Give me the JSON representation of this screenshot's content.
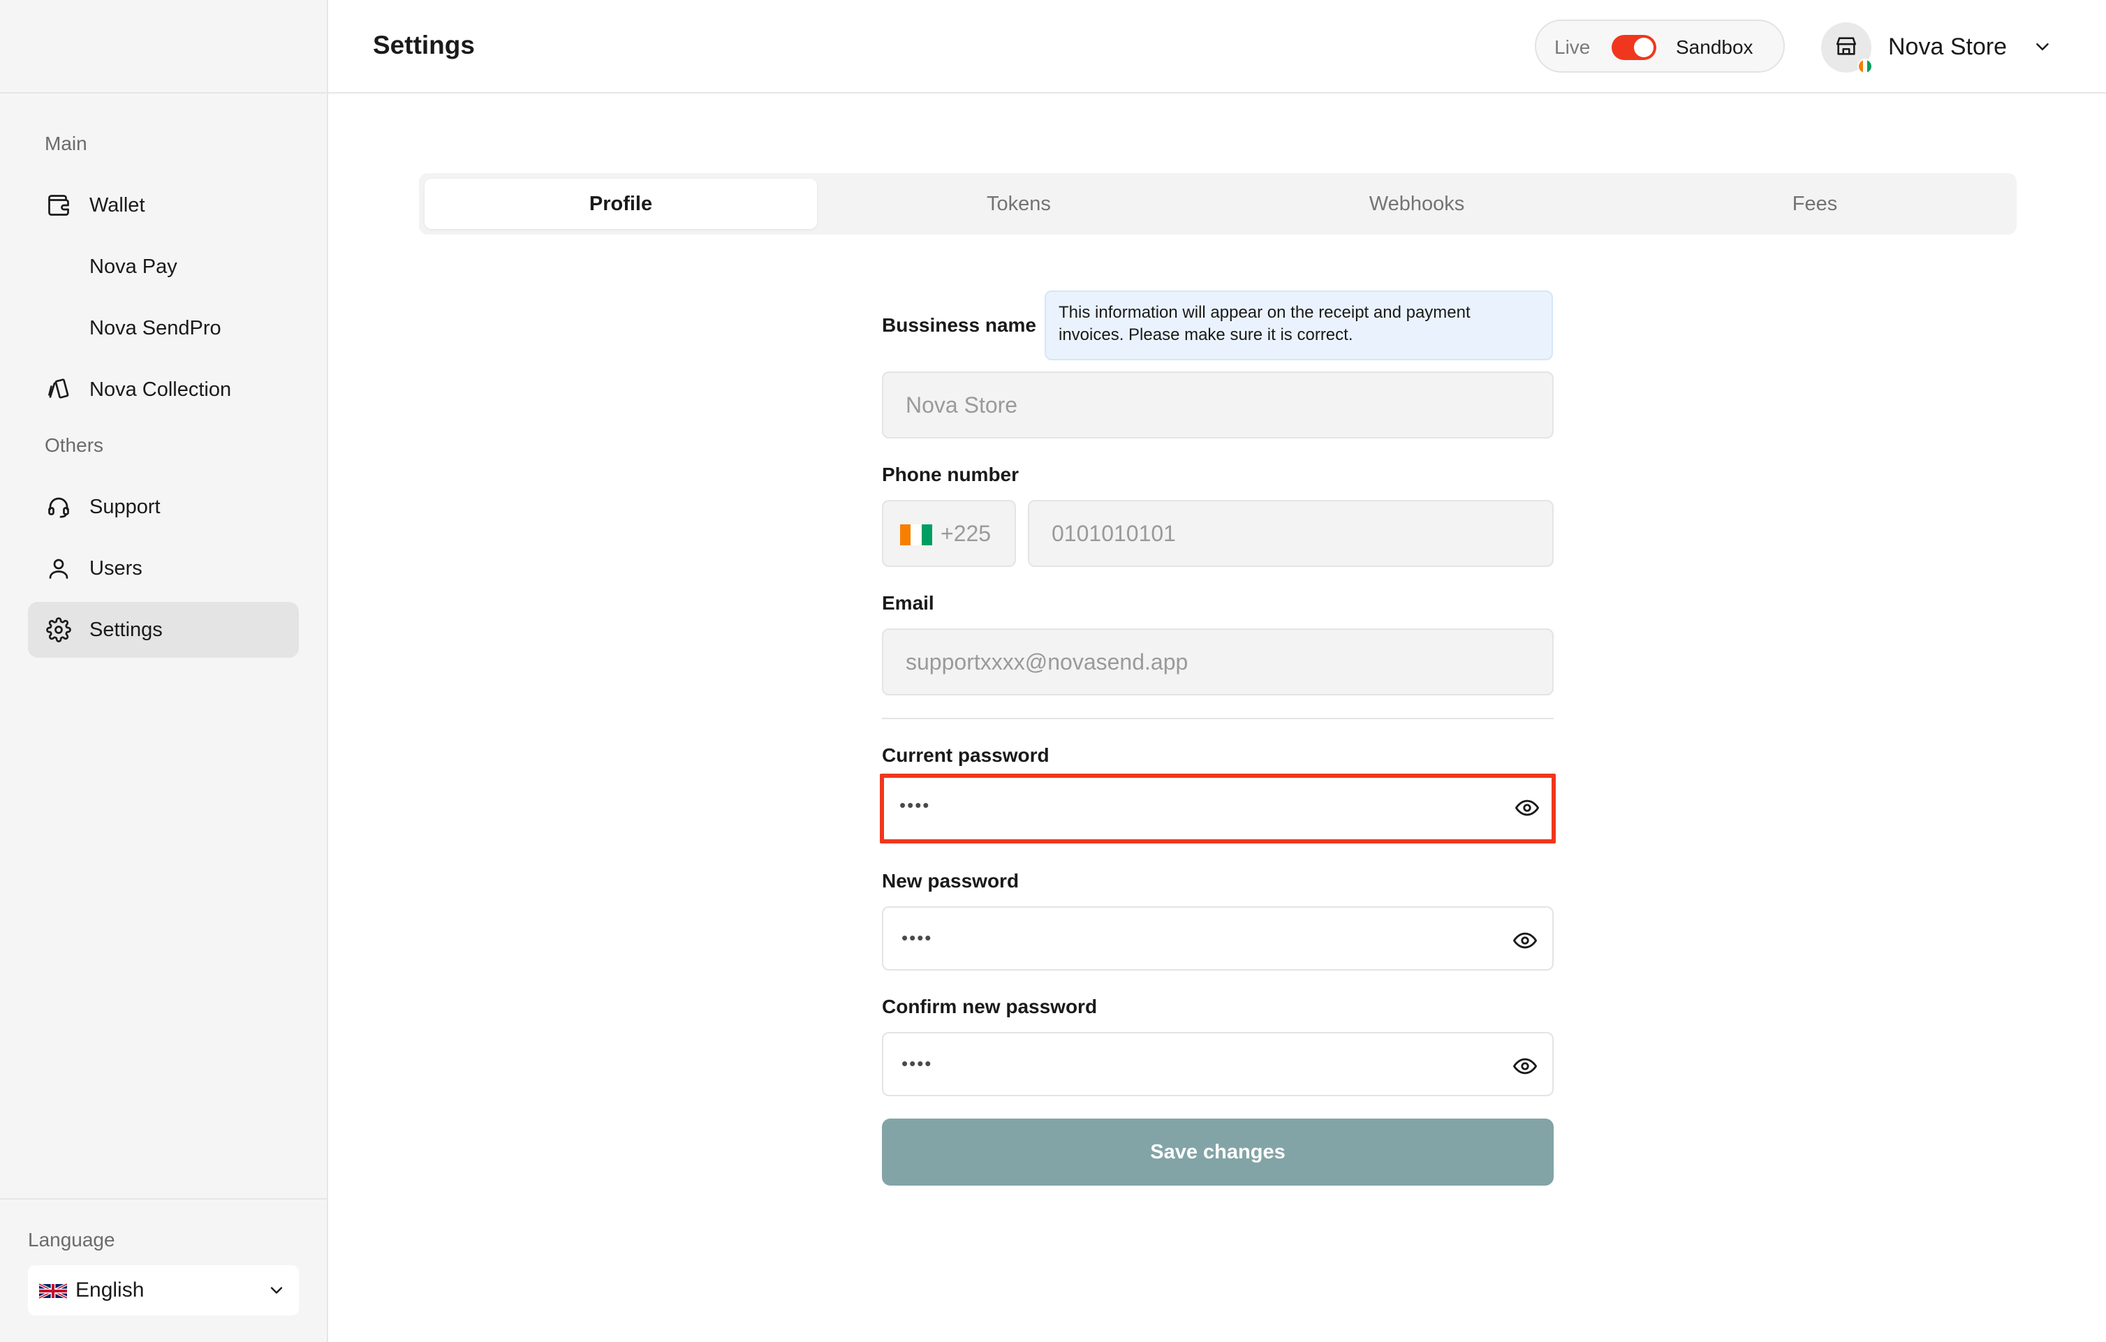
{
  "header": {
    "title": "Settings",
    "env_toggle": {
      "live_label": "Live",
      "sandbox_label": "Sandbox",
      "active": "sandbox"
    },
    "store_name": "Nova Store"
  },
  "sidebar": {
    "section_main": "Main",
    "section_others": "Others",
    "items": [
      {
        "label": "Wallet",
        "icon": "wallet-icon"
      },
      {
        "label": "Nova Pay",
        "icon": ""
      },
      {
        "label": "Nova SendPro",
        "icon": ""
      },
      {
        "label": "Nova Collection",
        "icon": "collection-icon"
      },
      {
        "label": "Support",
        "icon": "headset-icon"
      },
      {
        "label": "Users",
        "icon": "user-icon"
      },
      {
        "label": "Settings",
        "icon": "gear-icon",
        "active": true
      }
    ],
    "language": {
      "title": "Language",
      "selected": "English"
    }
  },
  "tabs": [
    {
      "label": "Profile",
      "active": true
    },
    {
      "label": "Tokens"
    },
    {
      "label": "Webhooks"
    },
    {
      "label": "Fees"
    }
  ],
  "form": {
    "business_name": {
      "label": "Bussiness name",
      "info": "This information will appear on the receipt and payment invoices. Please make sure it is correct.",
      "value": "Nova Store"
    },
    "phone": {
      "label": "Phone number",
      "country_code": "+225",
      "value": "0101010101"
    },
    "email": {
      "label": "Email",
      "value": "supportxxxx@novasend.app"
    },
    "current_password": {
      "label": "Current password",
      "value": "••••"
    },
    "new_password": {
      "label": "New password",
      "value": "••••"
    },
    "confirm_password": {
      "label": "Confirm new password",
      "value": "••••"
    },
    "save_label": "Save changes"
  },
  "colors": {
    "accent": "#f0371e",
    "save_button": "#83a4a7",
    "info_bg": "#eaf3fd"
  }
}
